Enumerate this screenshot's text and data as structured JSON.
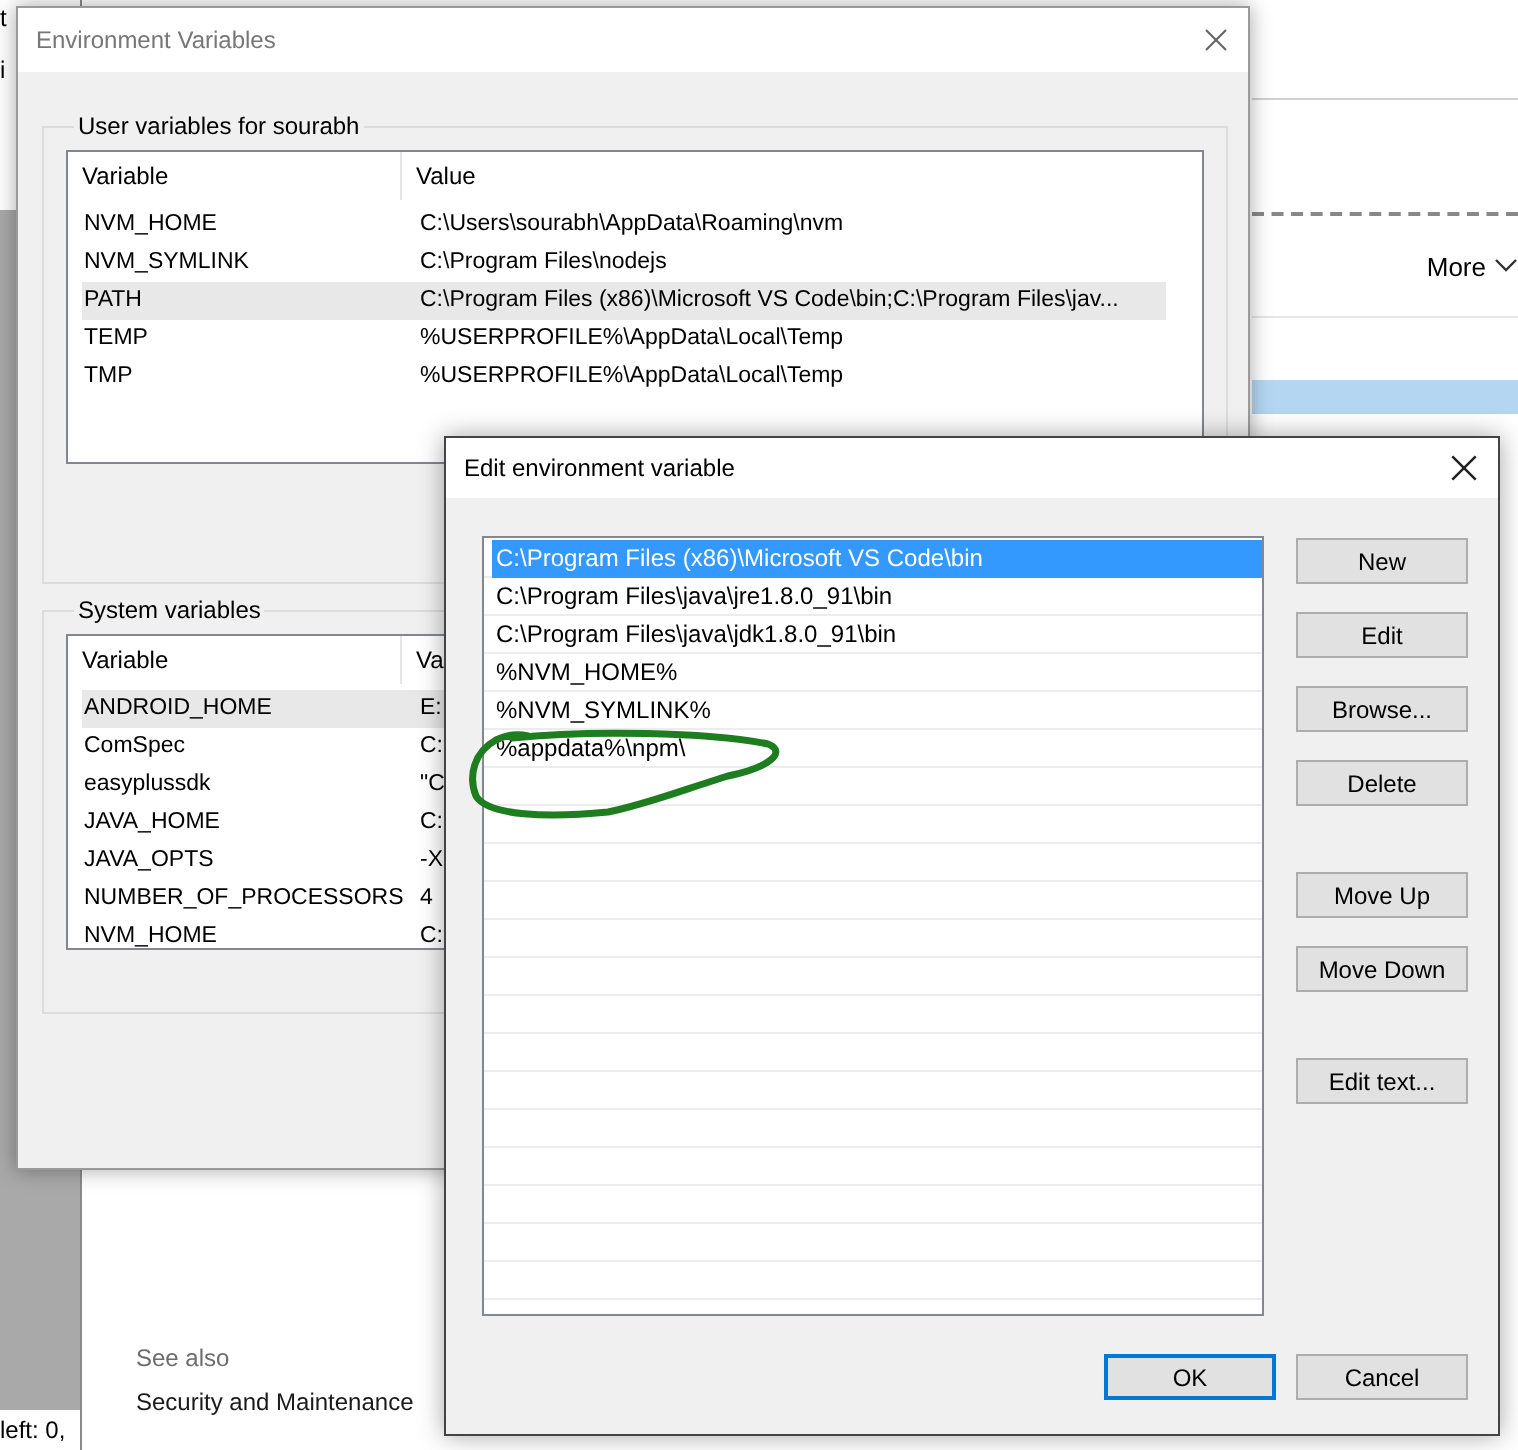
{
  "background_fragments": {
    "top": [
      "t",
      "i"
    ],
    "bottom": "left: 0,"
  },
  "control_panel": {
    "more_button": "More",
    "see_also": {
      "heading": "See also",
      "links": [
        "Security and Maintenance"
      ]
    }
  },
  "environment_variables": {
    "title": "Environment Variables",
    "user_variables": {
      "label": "User variables for sourabh",
      "columns": [
        "Variable",
        "Value"
      ],
      "rows": [
        {
          "variable": "NVM_HOME",
          "value": "C:\\Users\\sourabh\\AppData\\Roaming\\nvm",
          "selected": false
        },
        {
          "variable": "NVM_SYMLINK",
          "value": "C:\\Program Files\\nodejs",
          "selected": false
        },
        {
          "variable": "PATH",
          "value": "C:\\Program Files (x86)\\Microsoft VS Code\\bin;C:\\Program Files\\jav...",
          "selected": true
        },
        {
          "variable": "TEMP",
          "value": "%USERPROFILE%\\AppData\\Local\\Temp",
          "selected": false
        },
        {
          "variable": "TMP",
          "value": "%USERPROFILE%\\AppData\\Local\\Temp",
          "selected": false
        }
      ]
    },
    "system_variables": {
      "label": "System variables",
      "columns": [
        "Variable",
        "Va"
      ],
      "rows": [
        {
          "variable": "ANDROID_HOME",
          "value": "E:",
          "selected": true
        },
        {
          "variable": "ComSpec",
          "value": "C:",
          "selected": false
        },
        {
          "variable": "easyplussdk",
          "value": "\"C",
          "selected": false
        },
        {
          "variable": "JAVA_HOME",
          "value": "C:",
          "selected": false
        },
        {
          "variable": "JAVA_OPTS",
          "value": "-X",
          "selected": false
        },
        {
          "variable": "NUMBER_OF_PROCESSORS",
          "value": "4",
          "selected": false
        },
        {
          "variable": "NVM_HOME",
          "value": "C:",
          "selected": false
        }
      ]
    }
  },
  "edit_variable": {
    "title": "Edit environment variable",
    "entries": [
      {
        "text": "C:\\Program Files (x86)\\Microsoft VS Code\\bin",
        "selected": true
      },
      {
        "text": "C:\\Program Files\\java\\jre1.8.0_91\\bin",
        "selected": false
      },
      {
        "text": "C:\\Program Files\\java\\jdk1.8.0_91\\bin",
        "selected": false
      },
      {
        "text": "%NVM_HOME%",
        "selected": false
      },
      {
        "text": "%NVM_SYMLINK%",
        "selected": false
      },
      {
        "text": "%appdata%\\npm\\",
        "selected": false
      }
    ],
    "button_groups": [
      [
        "New",
        "Edit",
        "Browse...",
        "Delete"
      ],
      [
        "Move Up",
        "Move Down"
      ],
      [
        "Edit text..."
      ]
    ],
    "ok_button": "OK",
    "cancel_button": "Cancel"
  }
}
